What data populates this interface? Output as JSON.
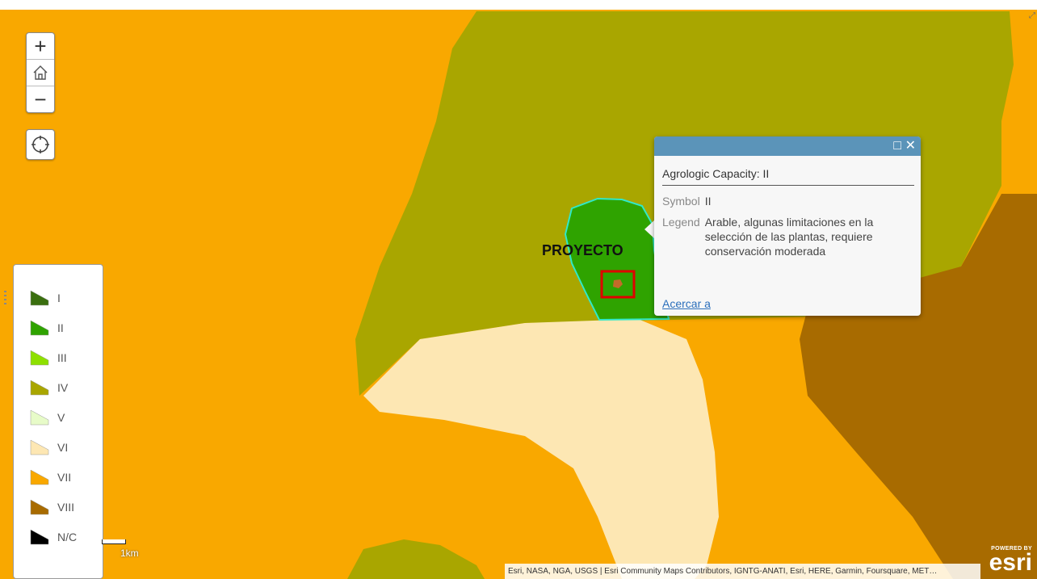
{
  "map": {
    "project_label": "PROYECTO",
    "scale_label": "1km",
    "attribution": "Esri, NASA, NGA, USGS | Esri Community Maps Contributors, IGNTG-ANATI, Esri, HERE, Garmin, Foursquare, MET…",
    "logo": {
      "powered_by": "POWERED BY",
      "name": "esri"
    },
    "colors": {
      "class_VII": "#f9a800",
      "class_IV": "#a9a600",
      "class_II": "#2fa300",
      "class_VI": "#fde7b3",
      "class_VIII": "#a86b00",
      "selection_outline": "#30e8c8",
      "project_marker": "#e00000"
    }
  },
  "controls": {
    "zoom_in_icon": "plus-icon",
    "home_icon": "home-icon",
    "zoom_out_icon": "minus-icon",
    "locate_icon": "locate-icon"
  },
  "legend": {
    "items": [
      {
        "label": "I",
        "color": "#3a6f0f"
      },
      {
        "label": "II",
        "color": "#2fa300"
      },
      {
        "label": "III",
        "color": "#8ee000"
      },
      {
        "label": "IV",
        "color": "#a9a600"
      },
      {
        "label": "V",
        "color": "#e7fbc8"
      },
      {
        "label": "VI",
        "color": "#fde7b3"
      },
      {
        "label": "VII",
        "color": "#f9a800"
      },
      {
        "label": "VIII",
        "color": "#a86b00"
      },
      {
        "label": "N/C",
        "color": "#000000"
      }
    ]
  },
  "popup": {
    "title": "Agrologic Capacity: II",
    "symbol_key": "Symbol",
    "symbol_value": "II",
    "legend_key": "Legend",
    "legend_value": "Arable, algunas limitaciones en la selección de las plantas, requiere conservación moderada",
    "zoom_link": "Acercar a",
    "header_color": "#5b94b9"
  }
}
